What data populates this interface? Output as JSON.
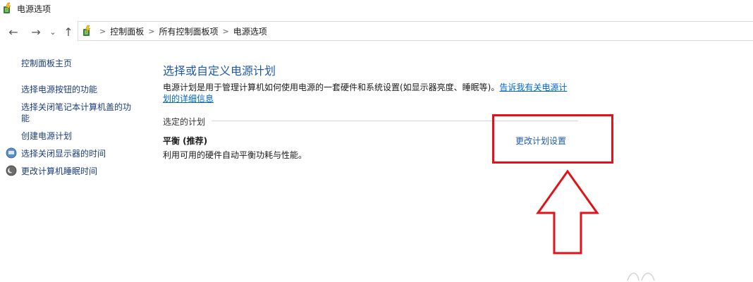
{
  "window": {
    "title": "电源选项"
  },
  "nav": {
    "back_glyph": "←",
    "forward_glyph": "→",
    "recent_glyph": "⌄",
    "up_glyph": "↑"
  },
  "breadcrumb": {
    "items": [
      "控制面板",
      "所有控制面板项",
      "电源选项"
    ],
    "separator": ">"
  },
  "sidebar": {
    "items": [
      {
        "label": "控制面板主页",
        "icon": null
      },
      {
        "label": "选择电源按钮的功能",
        "icon": null
      },
      {
        "label": "选择关闭笔记本计算机盖的功",
        "label_line2": "能",
        "icon": null
      },
      {
        "label": "创建电源计划",
        "icon": null
      },
      {
        "label": "选择关闭显示器的时间",
        "icon": "monitor-shield-icon"
      },
      {
        "label": "更改计算机睡眠时间",
        "icon": "moon-shield-icon"
      }
    ]
  },
  "main": {
    "title": "选择或自定义电源计划",
    "description": "电源计划是用于管理计算机如何使用电源的一套硬件和系统设置(如显示器亮度、睡眠等)。",
    "info_link_line1": "告诉我有关电源计",
    "info_link_line2": "划的详细信息",
    "section_label": "选定的计划",
    "plan_name": "平衡 (推荐)",
    "plan_description": "利用可用的硬件自动平衡功耗与性能。",
    "change_plan_link": "更改计划设置"
  },
  "colors": {
    "link": "#1e5aa8",
    "annotation": "#e0131a"
  }
}
